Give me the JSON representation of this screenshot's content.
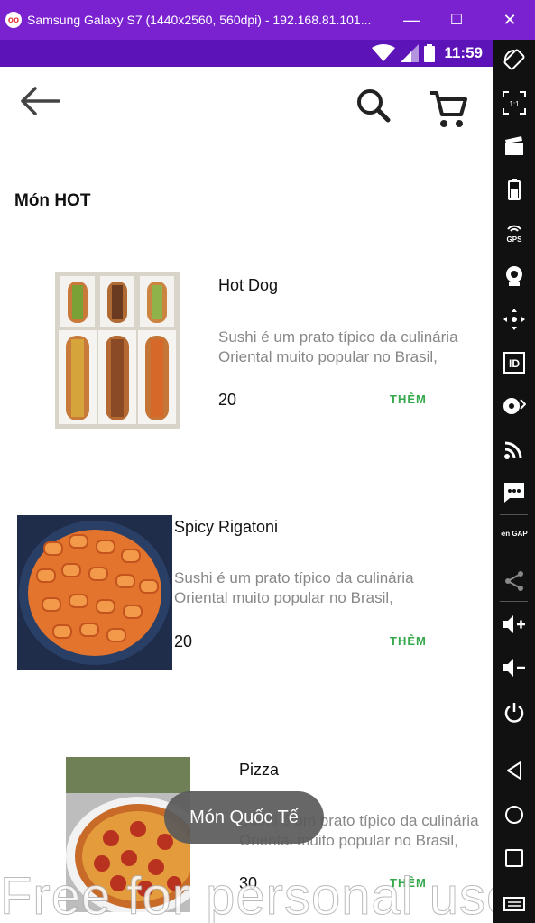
{
  "window": {
    "title": "Samsung Galaxy S7 (1440x2560, 560dpi) - 192.168.81.101...",
    "controls": {
      "minimize": "—",
      "maximize": "☐",
      "close": "✕"
    }
  },
  "status_bar": {
    "time": "11:59"
  },
  "app": {
    "section_title": "Món HOT",
    "foods": [
      {
        "name": "Hot Dog",
        "desc": "Sushi é um prato típico da culinária Oriental muito popular no Brasil,",
        "price": "20",
        "add_label": "THÊM"
      },
      {
        "name": "Spicy Rigatoni",
        "desc": "Sushi é um prato típico da culinária Oriental muito popular no Brasil,",
        "price": "20",
        "add_label": "THÊM"
      },
      {
        "name": "Pizza",
        "desc": "Sushi é um prato típico da culinária Oriental muito popular no Brasil,",
        "price": "30",
        "add_label": "THÊM"
      }
    ],
    "toast": "Món Quốc Tế",
    "watermark": "Free for personal use"
  },
  "sidebar": {
    "tools": [
      "rotate-icon",
      "pixel-perfect-icon",
      "capture-icon",
      "battery-icon",
      "gps-icon",
      "camera-icon",
      "dpad-icon",
      "id-icon",
      "disk-icon",
      "cast-icon",
      "sms-icon",
      "open-gapps-icon",
      "share-icon",
      "volume-up-icon",
      "volume-down-icon",
      "power-icon",
      "back-icon",
      "home-icon",
      "recents-icon",
      "menu-icon"
    ],
    "pixel_label": "1:1",
    "gps_label": "GPS",
    "id_label": "ID",
    "gapps_label": "Open GAPPS"
  },
  "colors": {
    "titlebar": "#7b22d0",
    "statusbar": "#5c13b8",
    "accent_add": "#35a84b"
  }
}
